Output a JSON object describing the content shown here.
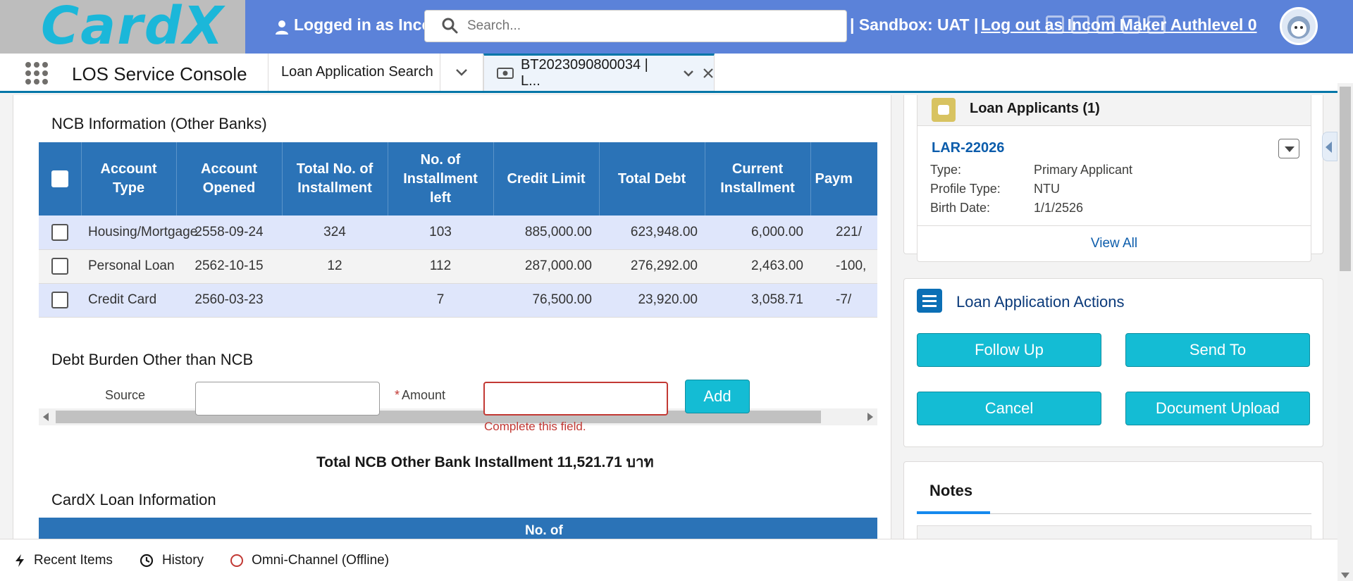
{
  "banner": {
    "logo_text": "CardX",
    "logged_in_text": "Logged in as Inco",
    "sandbox_text": "| Sandbox: UAT |",
    "logout_text": "Log out as Incom    Maker Authlevel 0"
  },
  "search": {
    "placeholder": "Search..."
  },
  "nav": {
    "app_name": "LOS Service Console",
    "tab_search": "Loan Application Search",
    "tab_active": "BT2023090800034 | L..."
  },
  "ncb": {
    "title": "NCB Information (Other Banks)",
    "columns": [
      "Account Type",
      "Account Opened",
      "Total No. of Installment",
      "No. of Installment left",
      "Credit Limit",
      "Total Debt",
      "Current Installment",
      "Paym"
    ],
    "rows": [
      {
        "type": "Housing/Mortgage",
        "opened": "2558-09-24",
        "total": "324",
        "left": "103",
        "limit": "885,000.00",
        "debt": "623,948.00",
        "current": "6,000.00",
        "pay": "221/"
      },
      {
        "type": "Personal Loan",
        "opened": "2562-10-15",
        "total": "12",
        "left": "112",
        "limit": "287,000.00",
        "debt": "276,292.00",
        "current": "2,463.00",
        "pay": "-100,"
      },
      {
        "type": "Credit Card",
        "opened": "2560-03-23",
        "total": "",
        "left": "7",
        "limit": "76,500.00",
        "debt": "23,920.00",
        "current": "3,058.71",
        "pay": "-7/"
      }
    ]
  },
  "debt_burden": {
    "title": "Debt Burden Other than NCB",
    "source_label": "Source",
    "amount_label": "Amount",
    "source_value": "",
    "amount_value": "",
    "error": "Complete this field.",
    "add_label": "Add",
    "total": "Total NCB Other Bank Installment 11,521.71 บาท"
  },
  "cardx_loan": {
    "title": "CardX Loan Information",
    "visible_header": "No. of"
  },
  "applicants": {
    "title": "Loan Applicants (1)",
    "id": "LAR-22026",
    "type_label": "Type:",
    "type_value": "Primary Applicant",
    "profile_label": "Profile Type:",
    "profile_value": "NTU",
    "birth_label": "Birth Date:",
    "birth_value": "1/1/2526",
    "view_all": "View All"
  },
  "actions": {
    "title": "Loan Application Actions",
    "follow_up": "Follow Up",
    "send_to": "Send To",
    "cancel": "Cancel",
    "document_upload": "Document Upload"
  },
  "notes": {
    "tab": "Notes"
  },
  "footer": {
    "recent": "Recent Items",
    "history": "History",
    "omni": "Omni-Channel (Offline)"
  },
  "colors": {
    "banner": "#5b82d9",
    "table_header": "#2b73b7",
    "action_button": "#14bcd4",
    "error": "#c23934"
  }
}
